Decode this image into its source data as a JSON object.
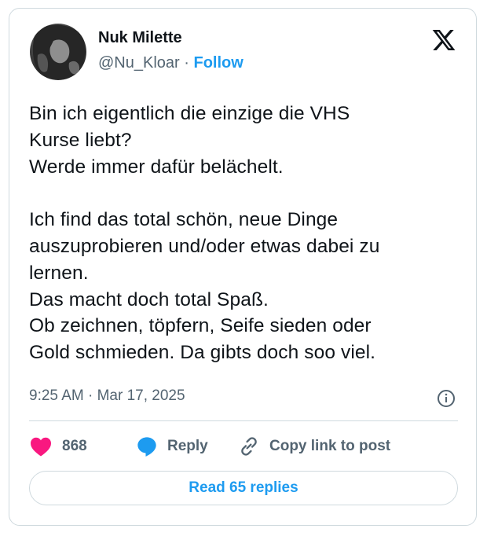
{
  "author": {
    "name": "Nuk Milette",
    "handle": "@Nu_Kloar",
    "separator": "·",
    "follow_label": "Follow"
  },
  "tweet": {
    "text": "Bin ich eigentlich die einzige die VHS\nKurse liebt?\nWerde immer dafür belächelt.\n\nIch find das total schön, neue Dinge\nauszuprobieren und/oder etwas dabei zu\nlernen.\nDas macht doch total Spaß.\nOb zeichnen, töpfern, Seife sieden oder\nGold schmieden. Da gibts doch soo viel.",
    "timestamp": "9:25 AM · Mar 17, 2025"
  },
  "actions": {
    "like_count": "868",
    "reply_label": "Reply",
    "copy_link_label": "Copy link to post"
  },
  "read_replies_label": "Read 65 replies",
  "colors": {
    "accent": "#1d9bf0",
    "like": "#f91880",
    "text": "#0f1419",
    "secondary": "#536471",
    "border": "#cfd9de"
  },
  "icons": [
    "x-logo-icon",
    "info-icon",
    "heart-icon",
    "reply-bubble-icon",
    "link-icon"
  ]
}
